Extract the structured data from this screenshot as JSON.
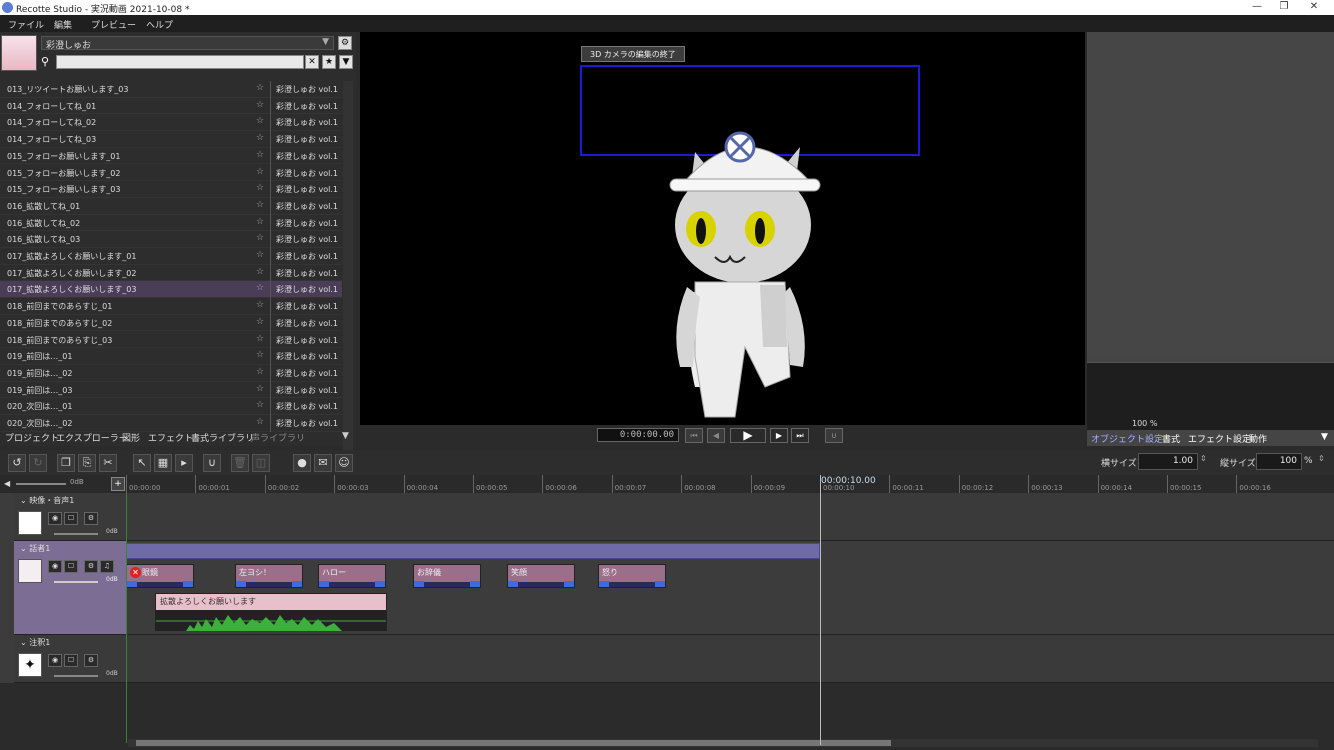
{
  "window": {
    "title": "Recotte Studio - 実況動画 2021-10-08 *"
  },
  "menu": [
    "ファイル",
    "編集",
    "プレビュー",
    "ヘルプ"
  ],
  "library": {
    "selected_character": "彩澄しゅお",
    "items": [
      {
        "name": "013_リツイートお願いします_03",
        "volume": "彩澄しゅお vol.1"
      },
      {
        "name": "014_フォローしてね_01",
        "volume": "彩澄しゅお vol.1"
      },
      {
        "name": "014_フォローしてね_02",
        "volume": "彩澄しゅお vol.1"
      },
      {
        "name": "014_フォローしてね_03",
        "volume": "彩澄しゅお vol.1"
      },
      {
        "name": "015_フォローお願いします_01",
        "volume": "彩澄しゅお vol.1"
      },
      {
        "name": "015_フォローお願いします_02",
        "volume": "彩澄しゅお vol.1"
      },
      {
        "name": "015_フォローお願いします_03",
        "volume": "彩澄しゅお vol.1"
      },
      {
        "name": "016_拡散してね_01",
        "volume": "彩澄しゅお vol.1"
      },
      {
        "name": "016_拡散してね_02",
        "volume": "彩澄しゅお vol.1"
      },
      {
        "name": "016_拡散してね_03",
        "volume": "彩澄しゅお vol.1"
      },
      {
        "name": "017_拡散よろしくお願いします_01",
        "volume": "彩澄しゅお vol.1"
      },
      {
        "name": "017_拡散よろしくお願いします_02",
        "volume": "彩澄しゅお vol.1"
      },
      {
        "name": "017_拡散よろしくお願いします_03",
        "volume": "彩澄しゅお vol.1"
      },
      {
        "name": "018_前回までのあらすじ_01",
        "volume": "彩澄しゅお vol.1"
      },
      {
        "name": "018_前回までのあらすじ_02",
        "volume": "彩澄しゅお vol.1"
      },
      {
        "name": "018_前回までのあらすじ_03",
        "volume": "彩澄しゅお vol.1"
      },
      {
        "name": "019_前回は…_01",
        "volume": "彩澄しゅお vol.1"
      },
      {
        "name": "019_前回は…_02",
        "volume": "彩澄しゅお vol.1"
      },
      {
        "name": "019_前回は…_03",
        "volume": "彩澄しゅお vol.1"
      },
      {
        "name": "020_次回は…_01",
        "volume": "彩澄しゅお vol.1"
      },
      {
        "name": "020_次回は…_02",
        "volume": "彩澄しゅお vol.1"
      }
    ],
    "selected_index": 12,
    "tabs": [
      "プロジェクト",
      "エクスプローラー",
      "図形",
      "エフェクト",
      "書式ライブラリ",
      "声ライブラリ"
    ]
  },
  "preview": {
    "camera_button": "3D カメラの編集の終了",
    "time": "0:00:00.00"
  },
  "right": {
    "zoom": "100 %",
    "tabs": [
      "オブジェクト設定",
      "書式",
      "エフェクト設定",
      "動作"
    ]
  },
  "toolbar": {
    "hsize_label": "横サイズ",
    "hsize": "1.00",
    "vsize_label": "縦サイズ",
    "vsize": "100",
    "vsize_unit": "%"
  },
  "ruler": {
    "labels": [
      "00:00:00",
      "00:00:01",
      "00:00:02",
      "00:00:03",
      "00:00:04",
      "00:00:05",
      "00:00:06",
      "00:00:07",
      "00:00:08",
      "00:00:09",
      "00:00:10",
      "00:00:11",
      "00:00:12",
      "00:00:13",
      "00:00:14",
      "00:00:15",
      "00:00:16"
    ],
    "current": "00:00:10.00",
    "volume": "0dB"
  },
  "tracks": {
    "video": {
      "name": "映像・音声1",
      "db": "0dB"
    },
    "speaker": {
      "name": "話者1",
      "db": "0dB",
      "clips": [
        "眼鏡",
        "左ヨシ！",
        "ハロー",
        "お辞儀",
        "笑顔",
        "怒り"
      ],
      "voice_clip": "拡散よろしくお願いします"
    },
    "note": {
      "name": "注釈1",
      "db": "0dB"
    }
  },
  "colors": {
    "selection": "#4a3d58",
    "track_selected": "#7c6d94",
    "clip": "#9b6f8a",
    "camera_rect": "#1a1ad8",
    "wave": "#3ab23a"
  }
}
